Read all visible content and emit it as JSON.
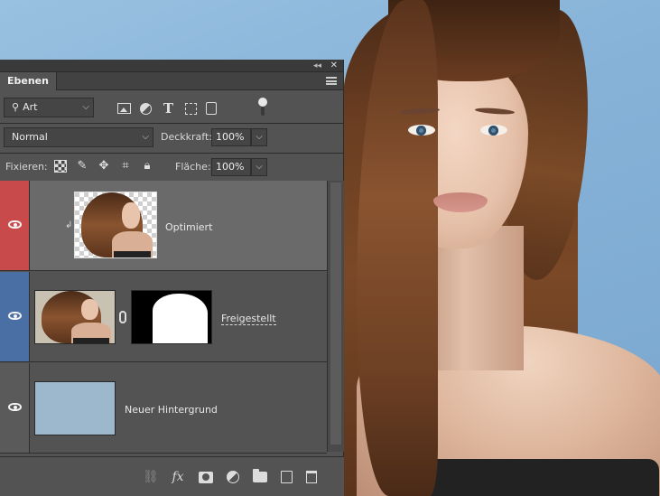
{
  "panel": {
    "title": "Ebenen",
    "filter": {
      "selected": "Art"
    },
    "blend_mode": "Normal",
    "opacity": {
      "label": "Deckkraft:",
      "value": "100%"
    },
    "lock": {
      "label": "Fixieren:"
    },
    "fill": {
      "label": "Fläche:",
      "value": "100%"
    }
  },
  "layers": [
    {
      "name": "Optimiert",
      "selected": true,
      "visible": true,
      "tag_color": "#c94a4a"
    },
    {
      "name": "Freigestellt",
      "selected": false,
      "visible": true,
      "tag_color": "#4a6fa5"
    },
    {
      "name": "Neuer Hintergrund",
      "selected": false,
      "visible": true,
      "tag_color": "#5a5a5a",
      "fill_color": "#9db8cc"
    }
  ],
  "colors": {
    "panel_bg": "#535353",
    "selected_layer_bg": "#6a6a6a",
    "canvas_bg": "#86b2d8"
  },
  "icons": {
    "filter_by": [
      "search-icon",
      "image-filter-icon",
      "adjustment-filter-icon",
      "type-filter-icon",
      "shape-filter-icon",
      "smart-object-filter-icon"
    ],
    "lock": [
      "lock-transparency-icon",
      "lock-pixels-icon",
      "lock-position-icon",
      "lock-artboard-icon",
      "lock-all-icon"
    ],
    "bottom": [
      "link-layers-icon",
      "fx-icon",
      "add-mask-icon",
      "new-adjustment-icon",
      "new-group-icon",
      "new-layer-icon",
      "trash-icon"
    ]
  }
}
